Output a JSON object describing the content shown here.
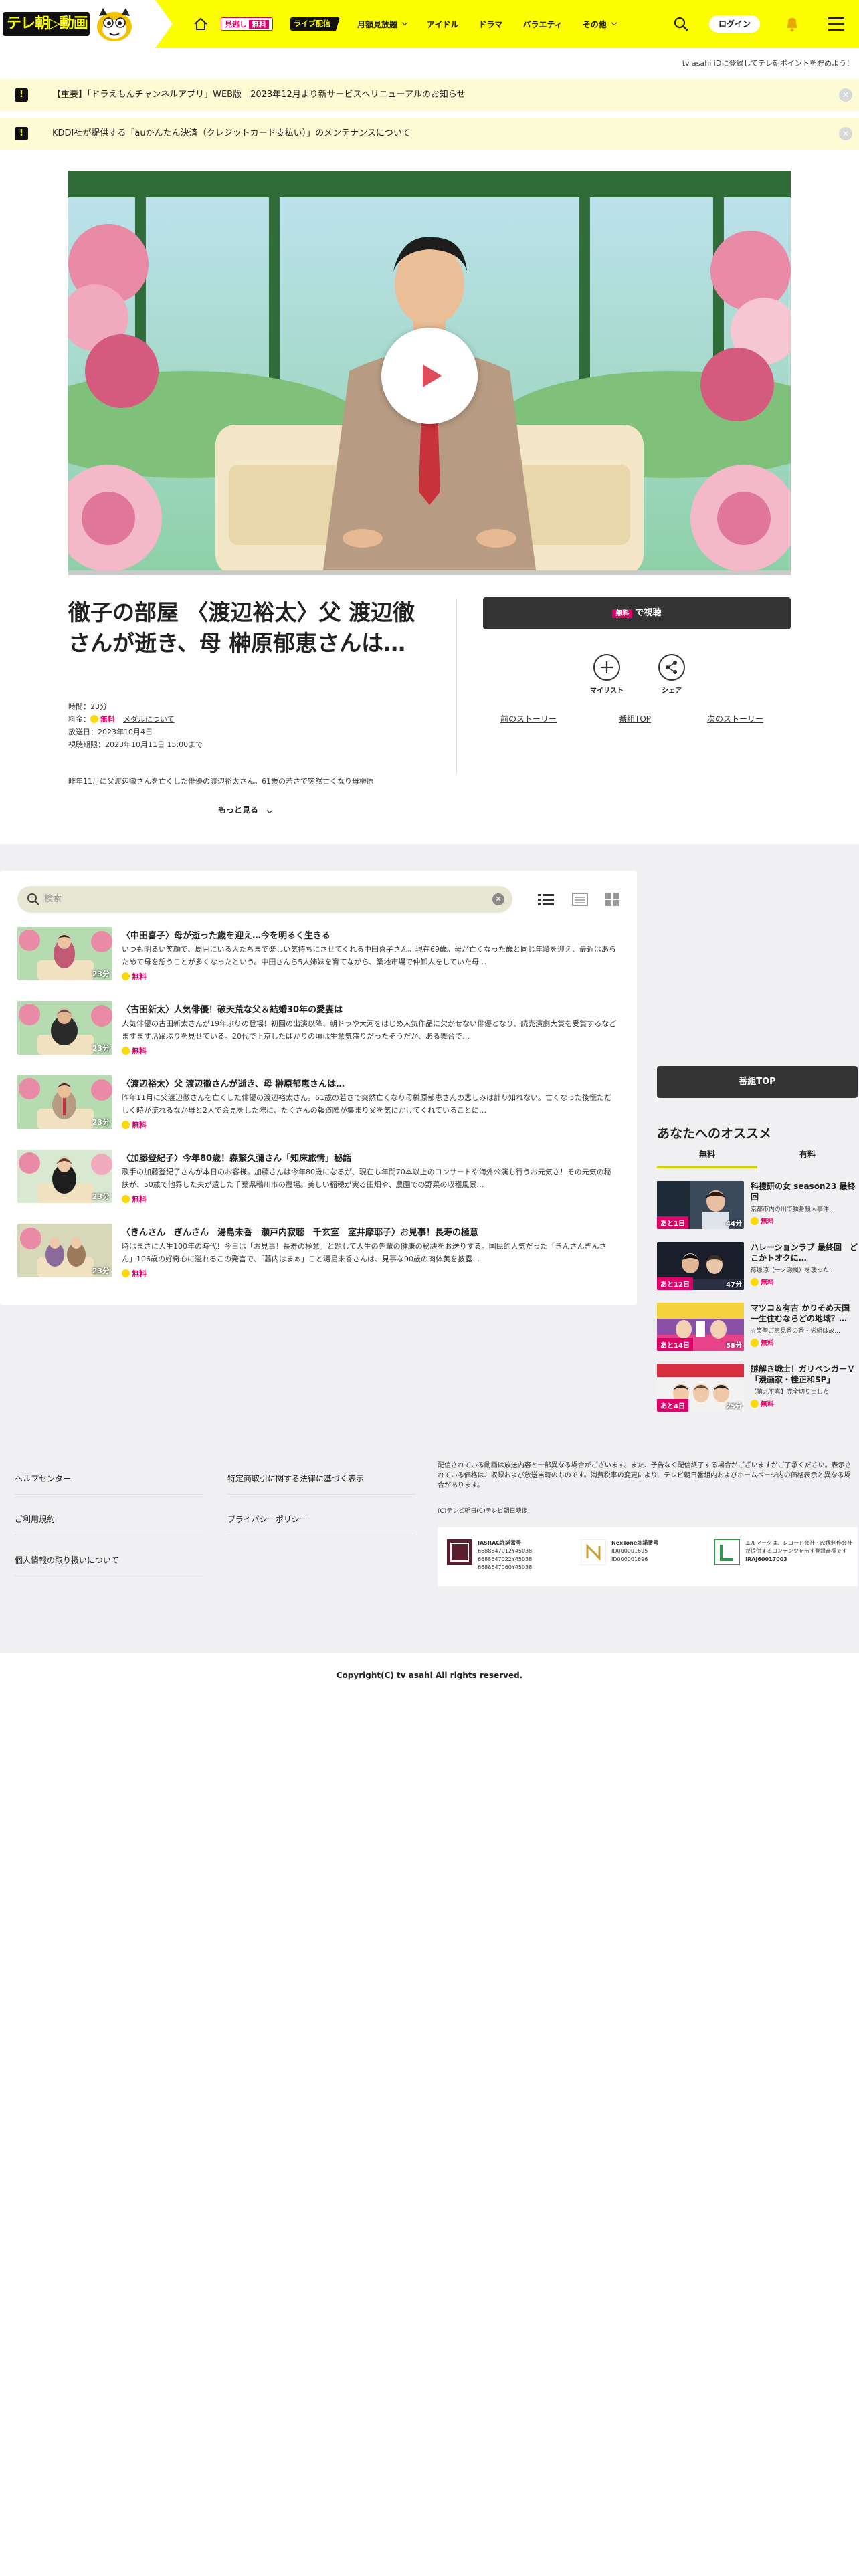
{
  "header": {
    "logo_text": "テレ朝▷動画",
    "nav_minogashi": "見逃し",
    "nav_minogashi_free": "無料",
    "nav_live": "ライブ配信",
    "nav_items": [
      "月額見放題",
      "アイドル",
      "ドラマ",
      "バラエティ",
      "その他"
    ],
    "login_label": "ログイン"
  },
  "promo_line": "tv asahi iDに登録してテレ朝ポイントを貯めよう！",
  "notices": [
    {
      "text": "【重要】「ドラえもんチャンネルアプリ」WEB版　2023年12月より新サービスへリニューアルのお知らせ"
    },
    {
      "text": "KDDI社が提供する「auかんたん決済（クレジットカード支払い）」のメンテナンスについて"
    }
  ],
  "episode": {
    "title": "徹子の部屋 〈渡辺裕太〉父 渡辺徹さんが逝き、母 榊原郁恵さんは…",
    "duration": "時間：23分",
    "price_label": "料金：",
    "price_value": "無料",
    "medal_link": "メダルについて",
    "air_date": "放送日：2023年10月4日",
    "deadline": "視聴期限：2023年10月11日 15:00まで",
    "description": "昨年11月に父渡辺徹さんを亡くした俳優の渡辺裕太さん。61歳の若さで突然亡くなり母榊原",
    "more_label": "もっと見る"
  },
  "actions": {
    "watch_free": "無料",
    "watch_label": "で視聴",
    "mylist": "マイリスト",
    "share": "シェア",
    "prev_story": "前のストーリー",
    "program_top": "番組TOP",
    "next_story": "次のストーリー"
  },
  "episode_search": {
    "placeholder": "検索"
  },
  "episodes": [
    {
      "title": "〈中田喜子〉母が逝った歳を迎え…今を明るく生きる",
      "desc": "いつも明るい笑顔で、周囲にいる人たちまで楽しい気持ちにさせてくれる中田喜子さん。現在69歳。母が亡くなった歳と同じ年齢を迎え、最近はあらためて母を想うことが多くなったという。中田さんら5人姉妹を育てながら、築地市場で仲卸人をしていた母…",
      "duration": "23分",
      "free": "無料"
    },
    {
      "title": "〈古田新太〉人気俳優！破天荒な父＆結婚30年の愛妻は",
      "desc": "人気俳優の古田新太さんが19年ぶりの登場！初回の出演以降、朝ドラや大河をはじめ人気作品に欠かせない俳優となり、読売演劇大賞を受賞するなどますます活躍ぶりを見せている。20代で上京したばかりの頃は生意気盛りだったそうだが、ある舞台で…",
      "duration": "23分",
      "free": "無料"
    },
    {
      "title": "〈渡辺裕太〉父 渡辺徹さんが逝き、母 榊原郁恵さんは…",
      "desc": "昨年11月に父渡辺徹さんを亡くした俳優の渡辺裕太さん。61歳の若さで突然亡くなり母榊原郁恵さんの悲しみは計り知れない。亡くなった後慌ただしく時が流れるなか母と2人で会見をした際に、たくさんの報道陣が集まり父を気にかけてくれていることに…",
      "duration": "23分",
      "free": "無料"
    },
    {
      "title": "〈加藤登紀子〉今年80歳！森繁久彌さん「知床旅情」秘話",
      "desc": "歌手の加藤登紀子さんが本日のお客様。加藤さんは今年80歳になるが、現在も年間70本以上のコンサートや海外公演も行うお元気さ！その元気の秘訣が、50歳で他界した夫が遺した千葉県鴨川市の農場。美しい稲穂が実る田畑や、農園での野菜の収穫風景…",
      "duration": "23分",
      "free": "無料"
    },
    {
      "title": "〈きんさん　ぎんさん　湯島未香　瀬戸内寂聴　千玄室　室井摩耶子〉お見事！長寿の極意",
      "desc": "時はまさに人生100年の時代！今日は「お見事！長寿の極意」と題して人生の先輩の健康の秘訣をお送りする。国民的人気だった「きんさんぎんさん」106歳の好奇心に溢れるこの発言で、「墓内はまぁ」こと湯島未香さんは、見事な90歳の肉体美を披露…",
      "duration": "23分",
      "free": "無料"
    }
  ],
  "sidebar": {
    "program_top": "番組TOP",
    "recommend_title": "あなたへのオススメ",
    "tabs": [
      "無料",
      "有料"
    ],
    "items": [
      {
        "title": "科捜研の女 season23 最終回",
        "sub": "京都市内の川で独身殺人事件…",
        "badge": "あと1日",
        "duration": "44分",
        "free": "無料"
      },
      {
        "title": "ハレーションラブ 最終回　どこかトオクに…",
        "sub": "篠原涼（一ノ瀬颯）を襲った…",
        "badge": "あと12日",
        "duration": "47分",
        "free": "無料"
      },
      {
        "title": "マツコ＆有吉 かりそめ天国 一生住むならどの地域？…",
        "sub": "☆笑聖ご意見番の番・労組は故…",
        "badge": "あと14日",
        "duration": "58分",
        "free": "無料"
      },
      {
        "title": "謎解き戦士！ガリベンガーＶ 「漫画家・桂正和SP」",
        "sub": "【第九平真】完全切り出した",
        "badge": "あと4日",
        "duration": "25分",
        "free": "無料"
      }
    ]
  },
  "footer": {
    "left_links": [
      "ヘルプセンター",
      "ご利用規約",
      "個人情報の取り扱いについて"
    ],
    "mid_links": [
      "特定商取引に関する法律に基づく表示",
      "プライバシーポリシー"
    ],
    "note": "配信されている動画は放送内容と一部異なる場合がございます。また、予告なく配信終了する場合がございますがご了承ください。表示されている価格は、収録および放送当時のものです。消費税率の変更により、テレビ朝日番組内およびホームページ内の価格表示と異なる場合があります。",
    "copy_small": "(C)テレビ朝日(C)テレビ朝日映像",
    "licenses": [
      {
        "name": "JASRAC許諾番号",
        "codes": [
          "6688647012Y45038",
          "6688647022Y45038",
          "6688647060Y45038"
        ]
      },
      {
        "name": "NexTone許諾番号",
        "codes": [
          "ID000001695",
          "ID000001696"
        ]
      },
      {
        "name": "エルマーク",
        "desc": "エルマークは、レコード会社・映像制作会社が提供するコンテンツを示す登録商標です",
        "code": "IRAJ60017003"
      }
    ],
    "copyright": "Copyright(C) tv asahi All rights reserved."
  }
}
